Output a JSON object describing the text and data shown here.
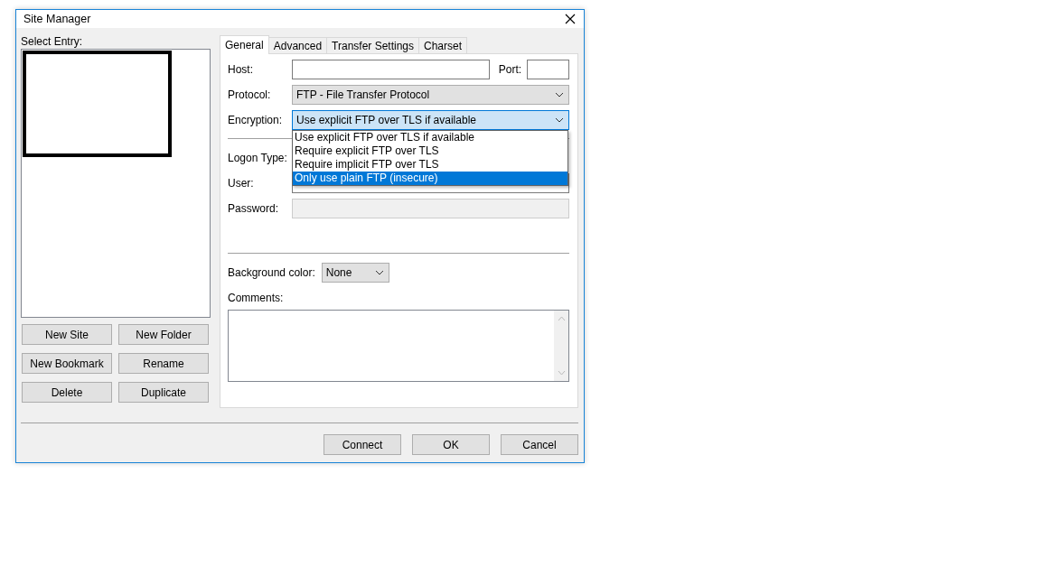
{
  "window": {
    "title": "Site Manager"
  },
  "select_entry": {
    "label": "Select Entry:"
  },
  "entry_buttons": [
    "New Site",
    "New Folder",
    "New Bookmark",
    "Rename",
    "Delete",
    "Duplicate"
  ],
  "tabs": [
    {
      "label": "General",
      "selected": true
    },
    {
      "label": "Advanced",
      "selected": false
    },
    {
      "label": "Transfer Settings",
      "selected": false
    },
    {
      "label": "Charset",
      "selected": false
    }
  ],
  "general": {
    "host": {
      "label": "Host:"
    },
    "port": {
      "label": "Port:"
    },
    "protocol": {
      "label": "Protocol:",
      "value": "FTP - File Transfer Protocol"
    },
    "encryption": {
      "label": "Encryption:",
      "value": "Use explicit FTP over TLS if available",
      "expanded": true,
      "options": [
        {
          "label": "Use explicit FTP over TLS if available",
          "highlighted": false
        },
        {
          "label": "Require explicit FTP over TLS",
          "highlighted": false
        },
        {
          "label": "Require implicit FTP over TLS",
          "highlighted": false
        },
        {
          "label": "Only use plain FTP (insecure)",
          "highlighted": true
        }
      ]
    },
    "logon_type": {
      "label": "Logon Type:"
    },
    "user": {
      "label": "User:"
    },
    "password": {
      "label": "Password:",
      "disabled": true
    },
    "background_color": {
      "label": "Background color:",
      "value": "None"
    },
    "comments": {
      "label": "Comments:"
    }
  },
  "buttons": [
    "Connect",
    "OK",
    "Cancel"
  ]
}
